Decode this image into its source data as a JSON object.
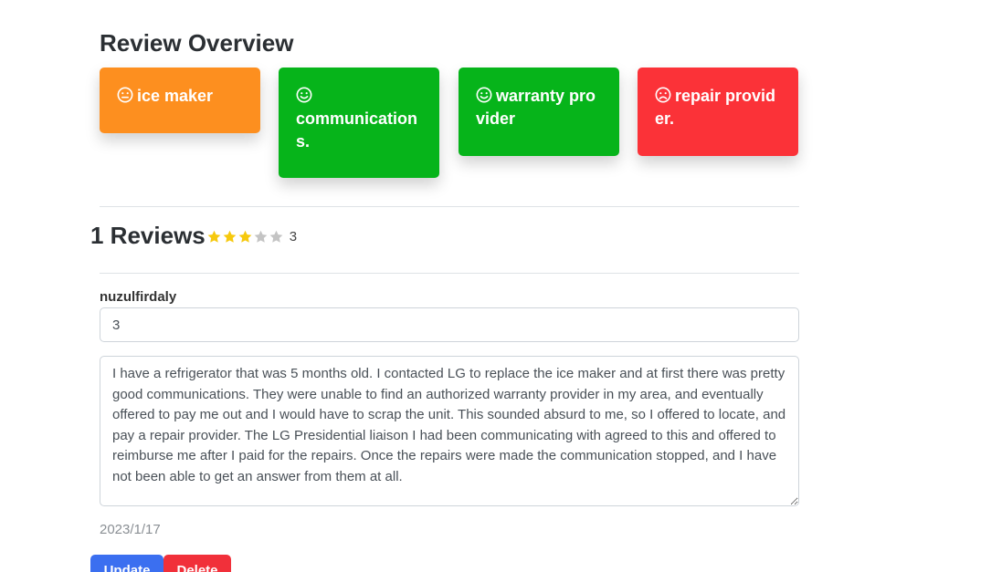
{
  "overview": {
    "title": "Review Overview",
    "cards": [
      {
        "label": "ice maker",
        "color": "#fd8f1f",
        "icon": "neutral-face-icon"
      },
      {
        "label": "communications.",
        "color": "#06b41a",
        "icon": "smile-face-icon"
      },
      {
        "label": "warranty provider",
        "color": "#06b41a",
        "icon": "smile-face-icon"
      },
      {
        "label": "repair provider.",
        "color": "#fb3238",
        "icon": "frown-face-icon"
      }
    ]
  },
  "reviews": {
    "title": "1 Reviews",
    "rating": 3,
    "rating_display": "3",
    "max_stars": 5,
    "star_filled_color": "#f6c90e",
    "star_empty_color": "#c4c4c4"
  },
  "review": {
    "username": "nuzulfirdaly",
    "rating_value": "3",
    "text": "I have a refrigerator that was 5 months old. I contacted LG to replace the ice maker and at first there was pretty good communications. They were unable to find an authorized warranty provider in my area, and eventually offered to pay me out and I would have to scrap the unit. This sounded absurd to me, so I offered to locate, and pay a repair provider. The LG Presidential liaison I had been communicating with agreed to this and offered to reimburse me after I paid for the repairs. Once the repairs were made the communication stopped, and I have not been able to get an answer from them at all.",
    "date": "2023/1/17"
  },
  "actions": {
    "update_label": "Update",
    "delete_label": "Delete"
  }
}
